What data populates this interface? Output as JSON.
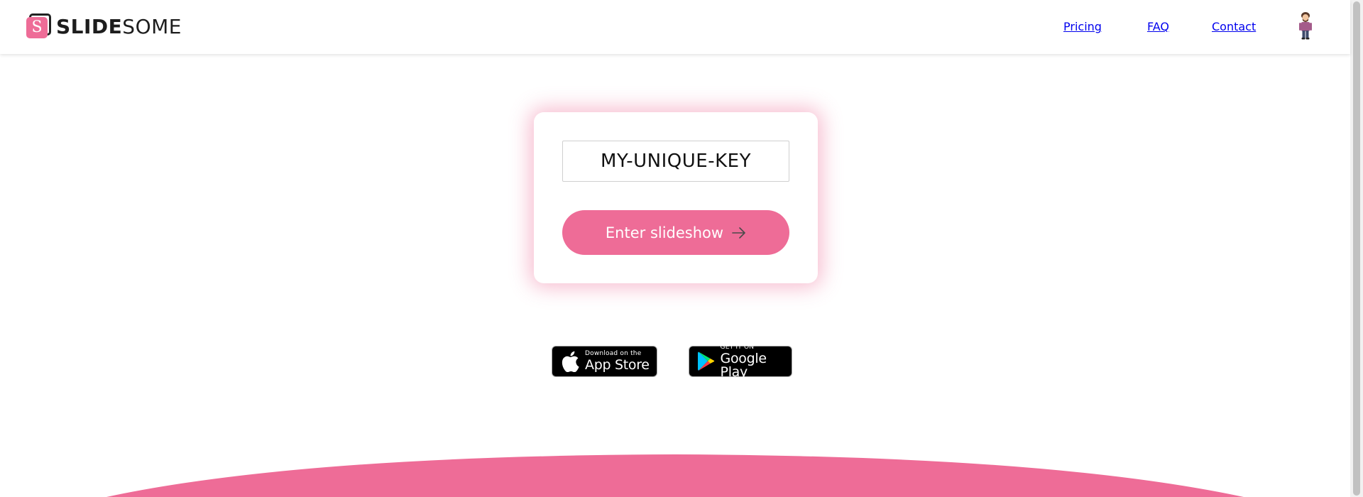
{
  "brand": {
    "logo_letter": "S",
    "name_bold": "SLIDE",
    "name_light": "SOME",
    "accent_color": "#ee6c97"
  },
  "nav": {
    "items": [
      {
        "label": "Pricing"
      },
      {
        "label": "FAQ"
      },
      {
        "label": "Contact"
      }
    ],
    "avatar_icon": "user-avatar-icon"
  },
  "key_card": {
    "key_value": "MY-UNIQUE-KEY",
    "button_label": "Enter slideshow",
    "button_icon": "arrow-right-icon"
  },
  "stores": {
    "apple": {
      "small": "Download on the",
      "big": "App Store",
      "icon": "apple-icon"
    },
    "google": {
      "small": "GET IT ON",
      "big": "Google Play",
      "icon": "google-play-icon"
    }
  }
}
